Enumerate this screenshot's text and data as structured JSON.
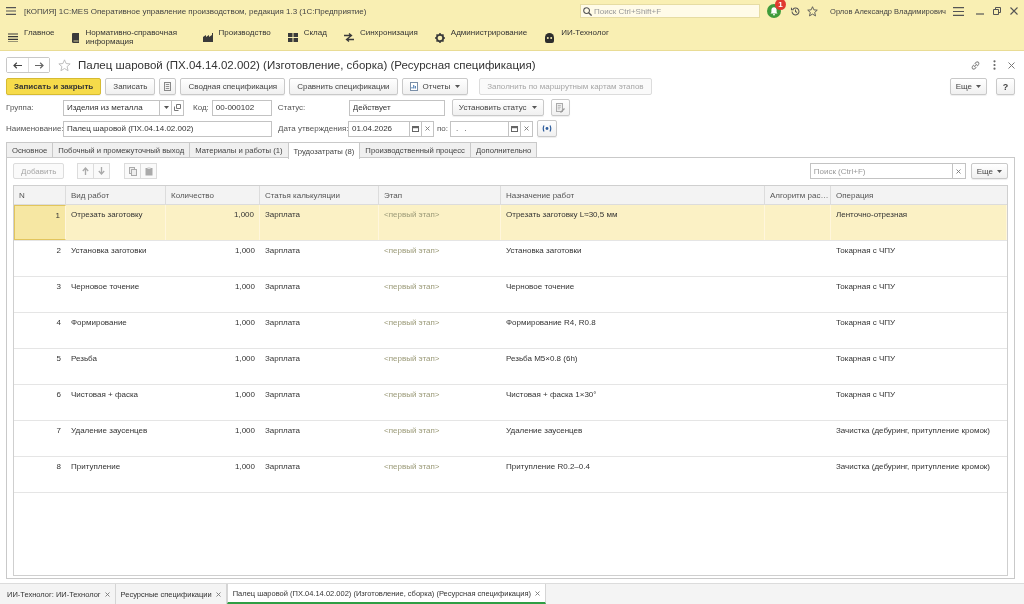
{
  "window": {
    "title": "[КОПИЯ] 1С:MES Оперативное управление производством, редакция 1.3 (1С:Предприятие)",
    "search": {
      "placeholder": "Поиск Ctrl+Shift+F"
    },
    "notification_count": "1",
    "user": "Орлов Александр Владимирович"
  },
  "sections": [
    {
      "label": "Главное"
    },
    {
      "label": "Нормативно-справочная информация"
    },
    {
      "label": "Производство"
    },
    {
      "label": "Склад"
    },
    {
      "label": "Синхронизация"
    },
    {
      "label": "Администрирование"
    },
    {
      "label": "ИИ-Технолог"
    }
  ],
  "form": {
    "title": "Палец шаровой (ПХ.04.14.02.002) (Изготовление, сборка) (Ресурсная спецификация)",
    "favorite": false,
    "commands": [
      {
        "kind": "primary",
        "label": "Записать и закрыть",
        "disabled": false
      },
      {
        "kind": "button",
        "label": "Записать",
        "disabled": false
      },
      {
        "kind": "icon",
        "disabled": false
      },
      {
        "kind": "button",
        "label": "Сводная спецификация",
        "disabled": false
      },
      {
        "kind": "button",
        "label": "Сравнить спецификации",
        "disabled": false
      },
      {
        "kind": "menu",
        "label": "Отчеты",
        "disabled": false
      },
      {
        "kind": "button",
        "label": "Заполнить по маршрутным картам этапов",
        "disabled": true
      }
    ],
    "more_button": "Еще",
    "help_button": "?",
    "group": {
      "label": "Группа:",
      "value": "Изделия из металла"
    },
    "code": {
      "label": "Код:",
      "value": "00-000102"
    },
    "status": {
      "label": "Статус:",
      "value": "Действует"
    },
    "set_status_button": "Установить статус",
    "name": {
      "label": "Наименование:",
      "value": "Палец шаровой (ПХ.04.14.02.002)"
    },
    "approval_date": {
      "label": "Дата утверждения:",
      "value": "01.04.2026"
    },
    "to_date": {
      "label": "по:",
      "value": ". ."
    },
    "tabs": [
      {
        "label": "Основное",
        "selected": false
      },
      {
        "label": "Побочный и промежуточный выход",
        "selected": false
      },
      {
        "label": "Материалы и работы (1)",
        "selected": false
      },
      {
        "label": "Трудозатраты (8)",
        "selected": true
      },
      {
        "label": "Производственный процесс",
        "selected": false
      },
      {
        "label": "Дополнительно",
        "selected": false
      }
    ]
  },
  "labor_table": {
    "toolbar": {
      "add_button": {
        "label": "Добавить",
        "disabled": true
      },
      "icon_buttons": [
        {
          "disabled": true
        },
        {
          "disabled": true
        },
        {
          "disabled": true
        },
        {
          "disabled": true
        }
      ],
      "search": {
        "placeholder": "Поиск (Ctrl+F)"
      },
      "more_button": "Еще"
    },
    "columns": [
      "N",
      "Вид работ",
      "Количество",
      "Статья калькуляции",
      "Этап",
      "Назначение работ",
      "Алгоритм рас…",
      "Операция"
    ],
    "rows": [
      {
        "n": "1",
        "work_type": "Отрезать заготовку",
        "quantity": "1,000",
        "cost_item": "Зарплата",
        "stage": "<первый этап>",
        "purpose": "Отрезать заготовку L≈30,5 мм",
        "operation": "Ленточно-отрезная",
        "selected": true
      },
      {
        "n": "2",
        "work_type": "Установка заготовки",
        "quantity": "1,000",
        "cost_item": "Зарплата",
        "stage": "<первый этап>",
        "purpose": "Установка заготовки",
        "operation": "Токарная с ЧПУ",
        "selected": false
      },
      {
        "n": "3",
        "work_type": "Черновое точение",
        "quantity": "1,000",
        "cost_item": "Зарплата",
        "stage": "<первый этап>",
        "purpose": "Черновое точение",
        "operation": "Токарная с ЧПУ",
        "selected": false
      },
      {
        "n": "4",
        "work_type": "Формирование",
        "quantity": "1,000",
        "cost_item": "Зарплата",
        "stage": "<первый этап>",
        "purpose": "Формирование R4, R0.8",
        "operation": "Токарная с ЧПУ",
        "selected": false
      },
      {
        "n": "5",
        "work_type": "Резьба",
        "quantity": "1,000",
        "cost_item": "Зарплата",
        "stage": "<первый этап>",
        "purpose": "Резьба M5×0.8 (6h)",
        "operation": "Токарная с ЧПУ",
        "selected": false
      },
      {
        "n": "6",
        "work_type": "Чистовая + фаска",
        "quantity": "1,000",
        "cost_item": "Зарплата",
        "stage": "<первый этап>",
        "purpose": "Чистовая + фаска 1×30°",
        "operation": "Токарная с ЧПУ",
        "selected": false
      },
      {
        "n": "7",
        "work_type": "Удаление заусенцев",
        "quantity": "1,000",
        "cost_item": "Зарплата",
        "stage": "<первый этап>",
        "purpose": "Удаление заусенцев",
        "operation": "Зачистка (дебуринг, притупление кромок)",
        "selected": false
      },
      {
        "n": "8",
        "work_type": "Притупление",
        "quantity": "1,000",
        "cost_item": "Зарплата",
        "stage": "<первый этап>",
        "purpose": "Притупление R0.2–0.4",
        "operation": "Зачистка (дебуринг, притупление кромок)",
        "selected": false
      }
    ]
  },
  "open_windows": [
    {
      "label": "ИИ-Технолог: ИИ-Технолог",
      "selected": false
    },
    {
      "label": "Ресурсные спецификации",
      "selected": false
    },
    {
      "label": "Палец шаровой (ПХ.04.14.02.002) (Изготовление, сборка) (Ресурсная спецификация)",
      "selected": true
    }
  ]
}
